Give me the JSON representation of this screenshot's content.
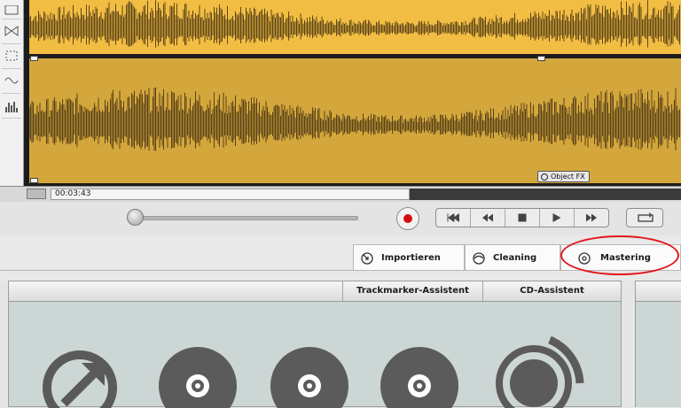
{
  "timeline": {
    "time": "00:03:43"
  },
  "waveform": {
    "object_fx_label": "Object FX"
  },
  "tabs": [
    {
      "label": "Importieren",
      "icon": "import-icon"
    },
    {
      "label": "Cleaning",
      "icon": "cleaning-icon"
    },
    {
      "label": "Mastering",
      "icon": "mastering-icon",
      "highlighted": true
    }
  ],
  "panel": {
    "headers": [
      "Trackmarker-Assistent",
      "CD-Assistent"
    ],
    "icons": [
      "export-arrow-icon",
      "cd-icon",
      "cd-icon",
      "cd-icon",
      "broadcast-icon"
    ]
  },
  "colors": {
    "waveform_top": "#f2bd43",
    "waveform_bottom": "#d4a73c",
    "record": "#d40e0e",
    "highlight_ring": "#e3161a",
    "panel_bg": "#ccd6d4"
  }
}
